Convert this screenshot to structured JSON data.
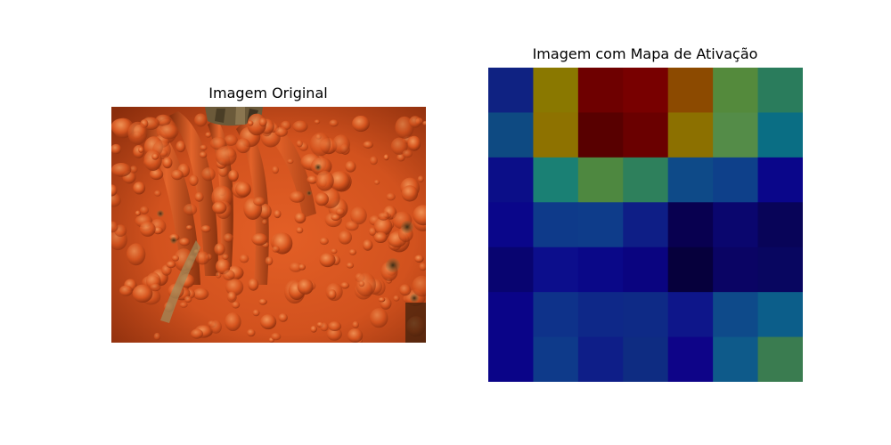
{
  "figure": {
    "left_title": "Imagem Original",
    "right_title": "Imagem com Mapa de Ativação"
  },
  "original_image": {
    "subject": "close-up of a warty orange pumpkin with ribbed stem",
    "colors": {
      "base": "#d2521e",
      "highlight": "#f08a4a",
      "shadow": "#5a1e08",
      "stem": "#6b5a3a",
      "background": "#1a1408"
    }
  },
  "chart_data": {
    "type": "heatmap",
    "title": "Imagem com Mapa de Ativação",
    "rows": 7,
    "cols": 7,
    "colormap": "jet",
    "value_range": [
      0,
      1
    ],
    "values": [
      [
        0.18,
        0.62,
        0.95,
        0.97,
        0.72,
        0.52,
        0.45
      ],
      [
        0.28,
        0.64,
        0.99,
        0.93,
        0.64,
        0.53,
        0.38
      ],
      [
        0.12,
        0.42,
        0.5,
        0.45,
        0.28,
        0.24,
        0.1
      ],
      [
        0.11,
        0.25,
        0.25,
        0.17,
        0.05,
        0.08,
        0.06
      ],
      [
        0.07,
        0.14,
        0.11,
        0.1,
        0.03,
        0.07,
        0.06
      ],
      [
        0.11,
        0.23,
        0.2,
        0.2,
        0.14,
        0.27,
        0.33
      ],
      [
        0.11,
        0.24,
        0.18,
        0.21,
        0.11,
        0.34,
        0.48
      ]
    ],
    "cell_colors": [
      [
        "#0f2282",
        "#8a7800",
        "#6e0000",
        "#780000",
        "#8c4a00",
        "#548a3c",
        "#2a7c5c"
      ],
      [
        "#0e4a82",
        "#8e7200",
        "#580000",
        "#6a0000",
        "#8c7000",
        "#548c48",
        "#0a6e84"
      ],
      [
        "#0b0e88",
        "#1a8074",
        "#4e8840",
        "#2e805c",
        "#0e4a88",
        "#0e408a",
        "#0a068a"
      ],
      [
        "#0a068a",
        "#0e3a8a",
        "#0e3c8a",
        "#0e1e86",
        "#080050",
        "#0a066e",
        "#080458"
      ],
      [
        "#080470",
        "#0c0e8c",
        "#0a0888",
        "#0a0480",
        "#06003c",
        "#0a0464",
        "#080660"
      ],
      [
        "#0a0488",
        "#0e328a",
        "#0e2888",
        "#0e2a86",
        "#0e168a",
        "#0e4a8a",
        "#0c5e8a"
      ],
      [
        "#0a0488",
        "#0e3a8a",
        "#0e1e88",
        "#0e2c82",
        "#0e0488",
        "#0e5a8a",
        "#3a7c50"
      ]
    ]
  }
}
